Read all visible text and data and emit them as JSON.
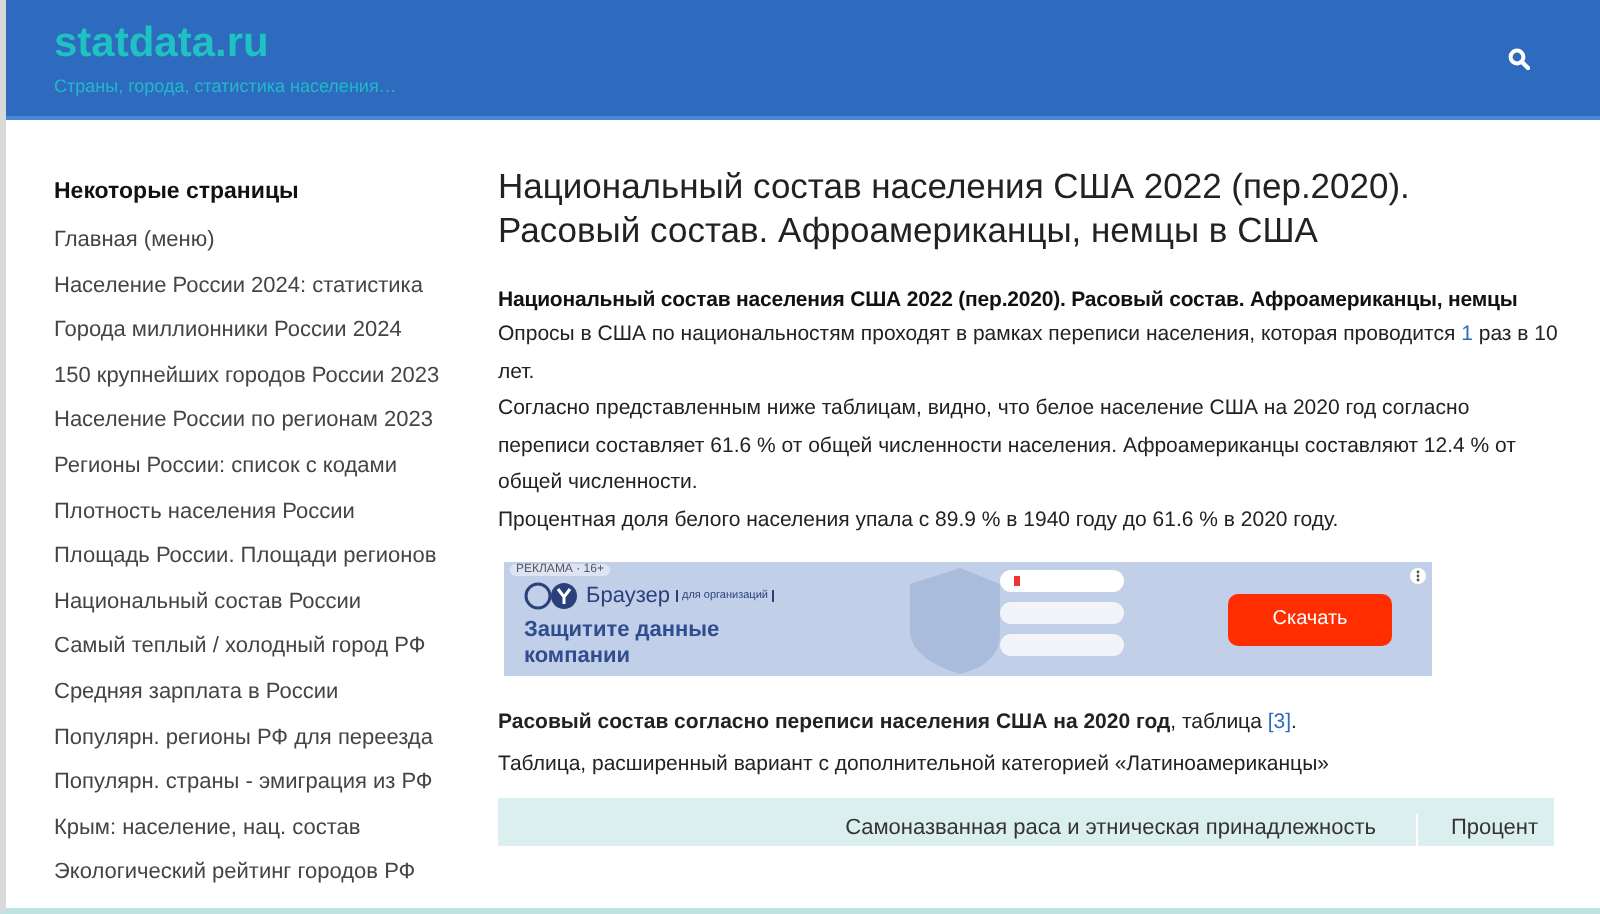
{
  "header": {
    "site_title": "statdata.ru",
    "tagline": "Страны, города, статистика населения…"
  },
  "sidebar": {
    "heading": "Некоторые страницы",
    "items": [
      {
        "label": "Главная (меню)"
      },
      {
        "label": "Население России 2024: статистика"
      },
      {
        "label": "Города миллионники России 2024"
      },
      {
        "label": "150 крупнейших городов России 2023"
      },
      {
        "label": "Население России по регионам 2023"
      },
      {
        "label": "Регионы России: список с кодами"
      },
      {
        "label": "Плотность населения России"
      },
      {
        "label": "Площадь России. Площади регионов"
      },
      {
        "label": "Национальный состав России"
      },
      {
        "label": "Самый теплый / холодный город РФ"
      },
      {
        "label": "Средняя зарплата в России"
      },
      {
        "label": "Популярн. регионы РФ для переезда"
      },
      {
        "label": "Популярн. страны - эмиграция из РФ"
      },
      {
        "label": "Крым: население, нац. состав"
      },
      {
        "label": "Экологический рейтинг городов РФ"
      }
    ]
  },
  "article": {
    "title": "Национальный состав населения США 2022 (пер.2020). Расовый состав. Афроамериканцы, немцы в США",
    "intro_heading": "Национальный состав населения США 2022 (пер.2020). Расовый состав. Афроамериканцы, немцы",
    "paragraphs": [
      [
        {
          "kind": "text",
          "text": "Опросы в США по национальностям проходят в рамках переписи населения, которая проводится "
        },
        {
          "kind": "link",
          "text": "1"
        },
        {
          "kind": "text",
          "text": " раз в 10 лет."
        }
      ],
      [
        {
          "kind": "text",
          "text": "Согласно представленным ниже таблицам, видно, что белое население США на 2020 год согласно переписи составляет 61.6 % от общей численности населения. Афроамериканцы составляют 12.4 % от общей численности."
        }
      ],
      [
        {
          "kind": "text",
          "text": "Процентная доля белого населения упала с 89.9 % в 1940 году до 61.6 % в 2020 году."
        }
      ]
    ],
    "ad": {
      "label": "РЕКЛАМА · 16+",
      "brand": "Браузер",
      "brand_note": "для организаций",
      "headline": "Защитите данные компании",
      "button": "Скачать"
    },
    "table_caption": [
      {
        "kind": "bold",
        "text": "Расовый состав согласно переписи населения США на 2020 год"
      },
      {
        "kind": "text",
        "text": ", таблица "
      },
      {
        "kind": "link",
        "text": "[3]"
      },
      {
        "kind": "text",
        "text": "."
      }
    ],
    "table_note": "Таблица, расширенный вариант с дополнительной категорией «Латиноамериканцы»",
    "table": {
      "columns": [
        "Самоназванная раса и этническая принадлежность",
        "Процент"
      ]
    }
  }
}
